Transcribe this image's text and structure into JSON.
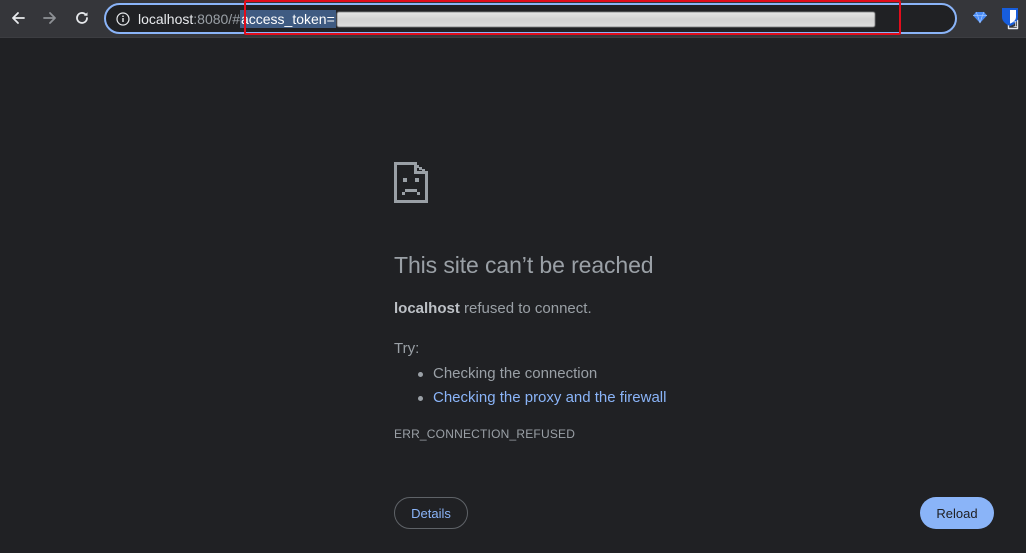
{
  "browser": {
    "url": {
      "host": "localhost",
      "port_and_hash": ":8080/#",
      "selected": "access_token="
    },
    "extension_badge": "1"
  },
  "error_page": {
    "title": "This site can’t be reached",
    "description_host": "localhost",
    "description_rest": " refused to connect.",
    "try_label": "Try:",
    "suggestions": [
      "Checking the connection",
      "Checking the proxy and the firewall"
    ],
    "error_code": "ERR_CONNECTION_REFUSED",
    "details_label": "Details",
    "reload_label": "Reload"
  },
  "colors": {
    "page_background": "#202124",
    "toolbar_background": "#35363a",
    "accent": "#8ab4f8",
    "highlight_box": "#e10d1c"
  }
}
